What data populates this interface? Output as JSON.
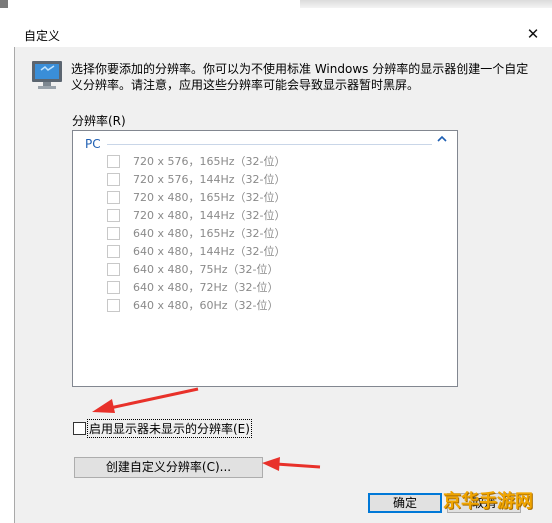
{
  "window": {
    "title": "自定义",
    "close_glyph": "✕"
  },
  "intro_text": "选择你要添加的分辨率。你可以为不使用标准 Windows 分辨率的显示器创建一个自定义分辨率。请注意，应用这些分辨率可能会导致显示器暂时黑屏。",
  "list": {
    "label": "分辨率(R)",
    "group": {
      "name": "PC",
      "caret": "^"
    },
    "items": [
      "720 x 576，165Hz（32-位）",
      "720 x 576，144Hz（32-位）",
      "720 x 480，165Hz（32-位）",
      "720 x 480，144Hz（32-位）",
      "640 x 480，165Hz（32-位）",
      "640 x 480，144Hz（32-位）",
      "640 x 480，75Hz（32-位）",
      "640 x 480，72Hz（32-位）",
      "640 x 480，60Hz（32-位）"
    ]
  },
  "enable_unshown": {
    "label": "启用显示器未显示的分辨率(E)",
    "checked": false
  },
  "buttons": {
    "create_custom": "创建自定义分辨率(C)...",
    "ok": "确定",
    "cancel": "取消"
  },
  "watermark": "京华手游网",
  "colors": {
    "accent": "#0078d7",
    "group_blue": "#1e5fb3",
    "annotation_red": "#e8312a",
    "watermark": "#f0a500"
  }
}
